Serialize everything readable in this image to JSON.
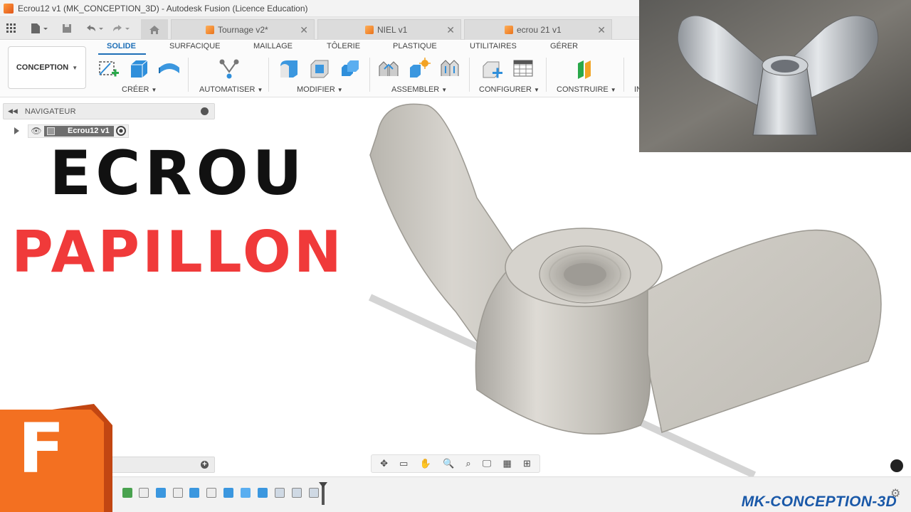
{
  "window": {
    "title": "Ecrou12 v1 (MK_CONCEPTION_3D) - Autodesk Fusion (Licence Education)"
  },
  "tabs": [
    {
      "label": "Tournage v2*"
    },
    {
      "label": "NIEL v1"
    },
    {
      "label": "ecrou 21 v1"
    }
  ],
  "ribbon": {
    "workspace": "CONCEPTION",
    "tabs": [
      "SOLIDE",
      "SURFACIQUE",
      "MAILLAGE",
      "TÔLERIE",
      "PLASTIQUE",
      "UTILITAIRES",
      "GÉRER"
    ],
    "groups": [
      "CRÉER",
      "AUTOMATISER",
      "MODIFIER",
      "ASSEMBLER",
      "CONFIGURER",
      "CONSTRUIRE",
      "IN"
    ]
  },
  "navigator": {
    "header": "NAVIGATEUR",
    "root_item": "Ecrou12 v1"
  },
  "overlay": {
    "line1": "ECROU",
    "line2": "PAPILLON",
    "line1_color": "#111111",
    "line2_color": "#f03a3a",
    "logo_letter": "F",
    "brand": "MK-CONCEPTION-3D",
    "brand_color": "#1958a8"
  },
  "colors": {
    "accent": "#1e6fb7",
    "fusion_orange": "#f37021"
  }
}
